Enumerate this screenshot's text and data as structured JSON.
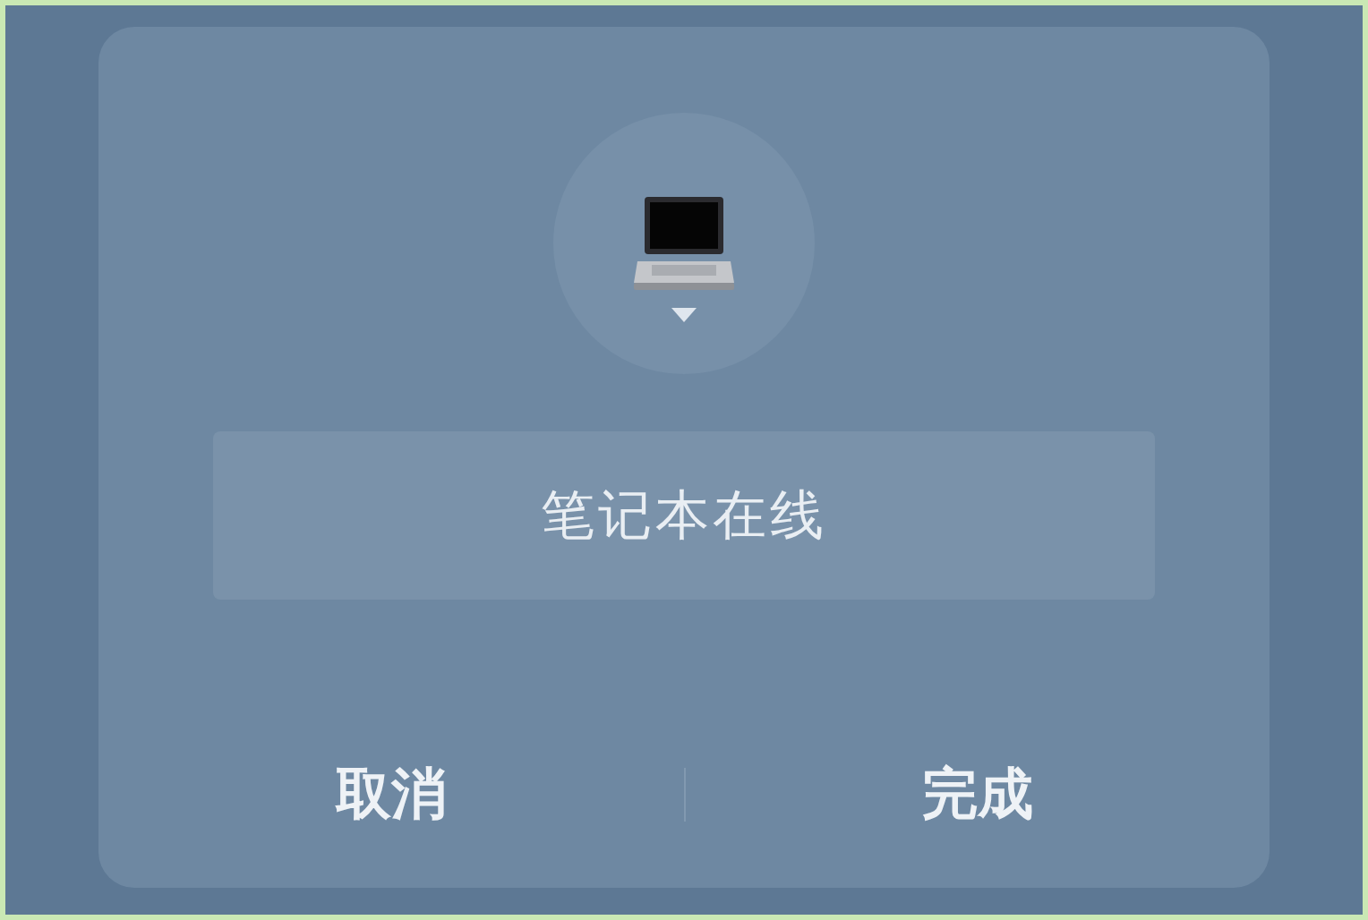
{
  "name_field": {
    "value": "笔记本在线"
  },
  "buttons": [
    {
      "label": "取消"
    },
    {
      "label": "完成"
    }
  ]
}
